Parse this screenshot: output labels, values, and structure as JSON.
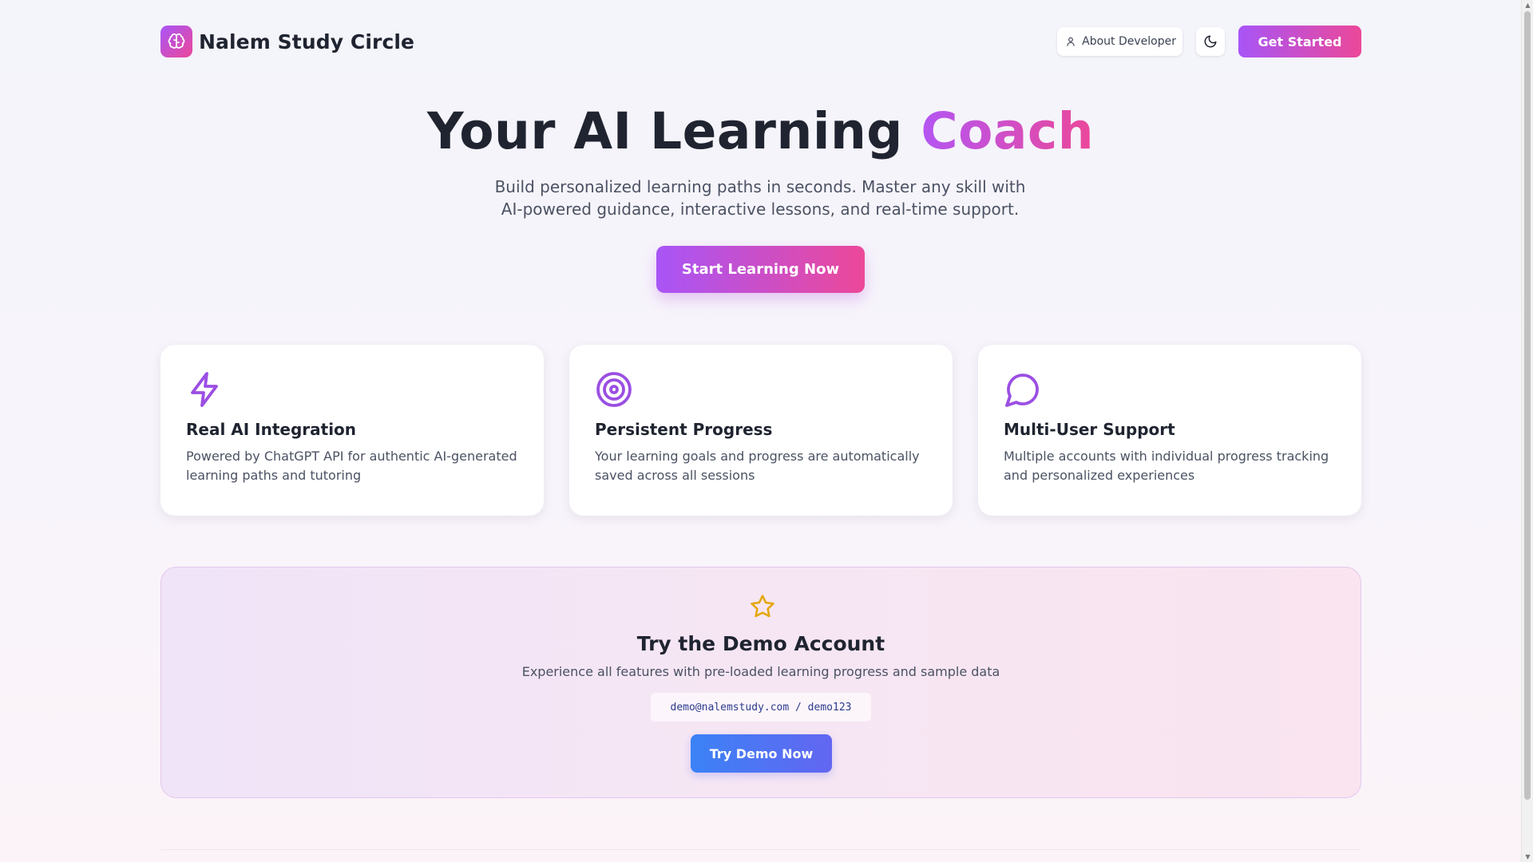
{
  "header": {
    "brand_name": "Nalem Study Circle",
    "about_label": "About Developer",
    "get_started_label": "Get Started"
  },
  "hero": {
    "title_main": "Your AI Learning ",
    "title_accent": "Coach",
    "subtitle_line1": "Build personalized learning paths in seconds. Master any skill with",
    "subtitle_line2": "AI-powered guidance, interactive lessons, and real-time support.",
    "cta_label": "Start Learning Now"
  },
  "features": [
    {
      "icon": "lightning-icon",
      "title": "Real AI Integration",
      "desc": "Powered by ChatGPT API for authentic AI-generated learning paths and tutoring"
    },
    {
      "icon": "target-icon",
      "title": "Persistent Progress",
      "desc": "Your learning goals and progress are automatically saved across all sessions"
    },
    {
      "icon": "chat-bubble-icon",
      "title": "Multi-User Support",
      "desc": "Multiple accounts with individual progress tracking and personalized experiences"
    }
  ],
  "demo": {
    "icon": "star-icon",
    "title": "Try the Demo Account",
    "subtitle": "Experience all features with pre-loaded learning progress and sample data",
    "credentials": "demo@nalemstudy.com / demo123",
    "button_label": "Try Demo Now"
  },
  "colors": {
    "accent_purple": "#a855f7",
    "accent_pink": "#ec4899",
    "demo_blue": "#3b82f6",
    "star_gold": "#eab308"
  }
}
